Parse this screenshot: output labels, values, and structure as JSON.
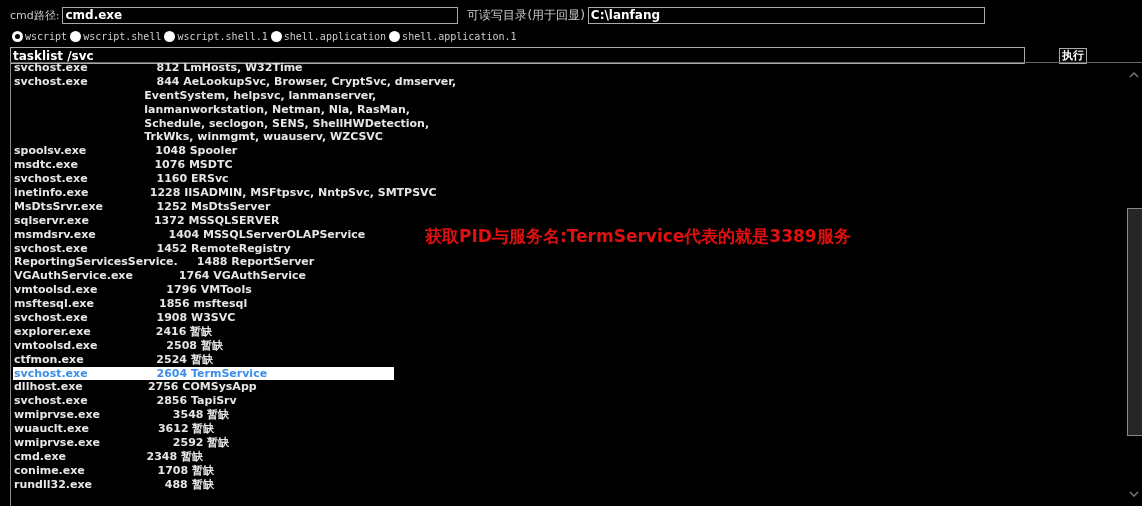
{
  "form": {
    "cmd_path_label": "cmd路径:",
    "cmd_path_value": "cmd.exe",
    "dir_label": "可读写目录(用于回显)",
    "dir_value": "C:\\lanfang"
  },
  "radios": [
    {
      "label": "wscript",
      "selected": true
    },
    {
      "label": "wscript.shell",
      "selected": false
    },
    {
      "label": "wscript.shell.1",
      "selected": false
    },
    {
      "label": "shell.application",
      "selected": false
    },
    {
      "label": "shell.application.1",
      "selected": false
    }
  ],
  "command": {
    "value": "tasklist /svc",
    "button": "执行"
  },
  "output": [
    {
      "text": "svchost.exe                  812 LmHosts, W32Time",
      "selected": false
    },
    {
      "text": "svchost.exe                  844 AeLookupSvc, Browser, CryptSvc, dmserver,",
      "selected": false
    },
    {
      "text": "                                  EventSystem, helpsvc, lanmanserver,",
      "selected": false
    },
    {
      "text": "                                  lanmanworkstation, Netman, Nla, RasMan,",
      "selected": false
    },
    {
      "text": "                                  Schedule, seclogon, SENS, ShellHWDetection,",
      "selected": false
    },
    {
      "text": "                                  TrkWks, winmgmt, wuauserv, WZCSVC",
      "selected": false
    },
    {
      "text": "spoolsv.exe                  1048 Spooler",
      "selected": false
    },
    {
      "text": "msdtc.exe                    1076 MSDTC",
      "selected": false
    },
    {
      "text": "svchost.exe                  1160 ERSvc",
      "selected": false
    },
    {
      "text": "inetinfo.exe                1228 IISADMIN, MSFtpsvc, NntpSvc, SMTPSVC",
      "selected": false
    },
    {
      "text": "MsDtsSrvr.exe              1252 MsDtsServer",
      "selected": false
    },
    {
      "text": "sqlservr.exe                 1372 MSSQLSERVER",
      "selected": false
    },
    {
      "text": "msmdsrv.exe                   1404 MSSQLServerOLAPService",
      "selected": false
    },
    {
      "text": "svchost.exe                  1452 RemoteRegistry",
      "selected": false
    },
    {
      "text": "ReportingServicesService.     1488 ReportServer",
      "selected": false
    },
    {
      "text": "VGAuthService.exe            1764 VGAuthService",
      "selected": false
    },
    {
      "text": "vmtoolsd.exe                  1796 VMTools",
      "selected": false
    },
    {
      "text": "msftesql.exe                 1856 msftesql",
      "selected": false
    },
    {
      "text": "svchost.exe                  1908 W3SVC",
      "selected": false
    },
    {
      "text": "explorer.exe                 2416 暂缺",
      "selected": false
    },
    {
      "text": "vmtoolsd.exe                  2508 暂缺",
      "selected": false
    },
    {
      "text": "ctfmon.exe                   2524 暂缺",
      "selected": false
    },
    {
      "text": "svchost.exe                  2604 TermService",
      "selected": true
    },
    {
      "text": "dllhost.exe                 2756 COMSysApp",
      "selected": false
    },
    {
      "text": "svchost.exe                  2856 TapiSrv",
      "selected": false
    },
    {
      "text": "wmiprvse.exe                   3548 暂缺",
      "selected": false
    },
    {
      "text": "wuauclt.exe                  3612 暂缺",
      "selected": false
    },
    {
      "text": "wmiprvse.exe                   2592 暂缺",
      "selected": false
    },
    {
      "text": "cmd.exe                     2348 暂缺",
      "selected": false
    },
    {
      "text": "conime.exe                   1708 暂缺",
      "selected": false
    },
    {
      "text": "rundll32.exe                   488 暂缺",
      "selected": false
    }
  ],
  "annotation": "获取PID与服务名:TermService代表的就是3389服务"
}
